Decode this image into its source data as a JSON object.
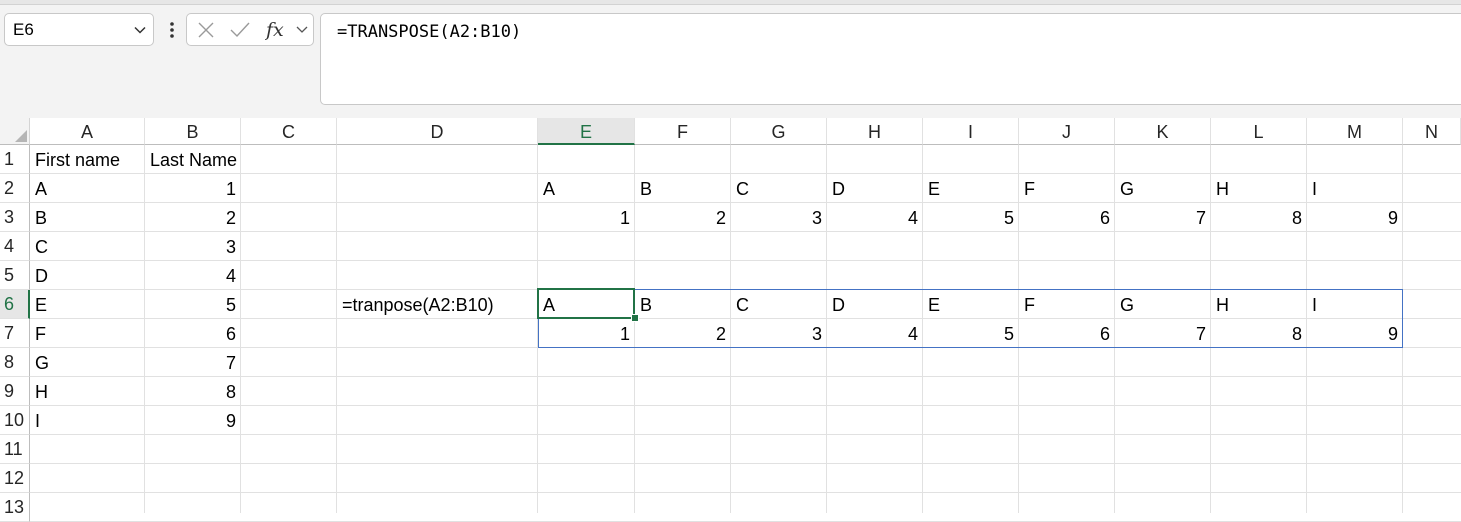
{
  "name_box": {
    "value": "E6"
  },
  "formula_bar": {
    "value": "=TRANSPOSE(A2:B10)"
  },
  "columns": [
    "A",
    "B",
    "C",
    "D",
    "E",
    "F",
    "G",
    "H",
    "I",
    "J",
    "K",
    "L",
    "M",
    "N"
  ],
  "rows": [
    "1",
    "2",
    "3",
    "4",
    "5",
    "6",
    "7",
    "8",
    "9",
    "10",
    "11",
    "12",
    "13"
  ],
  "active_cell": "E6",
  "cells": {
    "A1": "First name",
    "B1": "Last Name",
    "A2": "A",
    "B2": "1",
    "A3": "B",
    "B3": "2",
    "A4": "C",
    "B4": "3",
    "A5": "D",
    "B5": "4",
    "A6": "E",
    "B6": "5",
    "A7": "F",
    "B7": "6",
    "A8": "G",
    "B8": "7",
    "A9": "H",
    "B9": "8",
    "A10": "I",
    "B10": "9",
    "D6": "=tranpose(A2:B10)",
    "E2": "A",
    "F2": "B",
    "G2": "C",
    "H2": "D",
    "I2": "E",
    "J2": "F",
    "K2": "G",
    "L2": "H",
    "M2": "I",
    "E3": "1",
    "F3": "2",
    "G3": "3",
    "H3": "4",
    "I3": "5",
    "J3": "6",
    "K3": "7",
    "L3": "8",
    "M3": "9",
    "E6": "A",
    "F6": "B",
    "G6": "C",
    "H6": "D",
    "I6": "E",
    "J6": "F",
    "K6": "G",
    "L6": "H",
    "M6": "I",
    "E7": "1",
    "F7": "2",
    "G7": "3",
    "H7": "4",
    "I7": "5",
    "J7": "6",
    "K7": "7",
    "L7": "8",
    "M7": "9"
  },
  "colors": {
    "accent": "#217346",
    "spill_border": "#4472c4",
    "gridline": "#e1e1e1"
  },
  "icons": {
    "name_box_dropdown": "chevron-down-icon",
    "more": "more-vertical-icon",
    "cancel": "close-icon",
    "enter": "check-icon",
    "insert_function": "fx-icon"
  }
}
